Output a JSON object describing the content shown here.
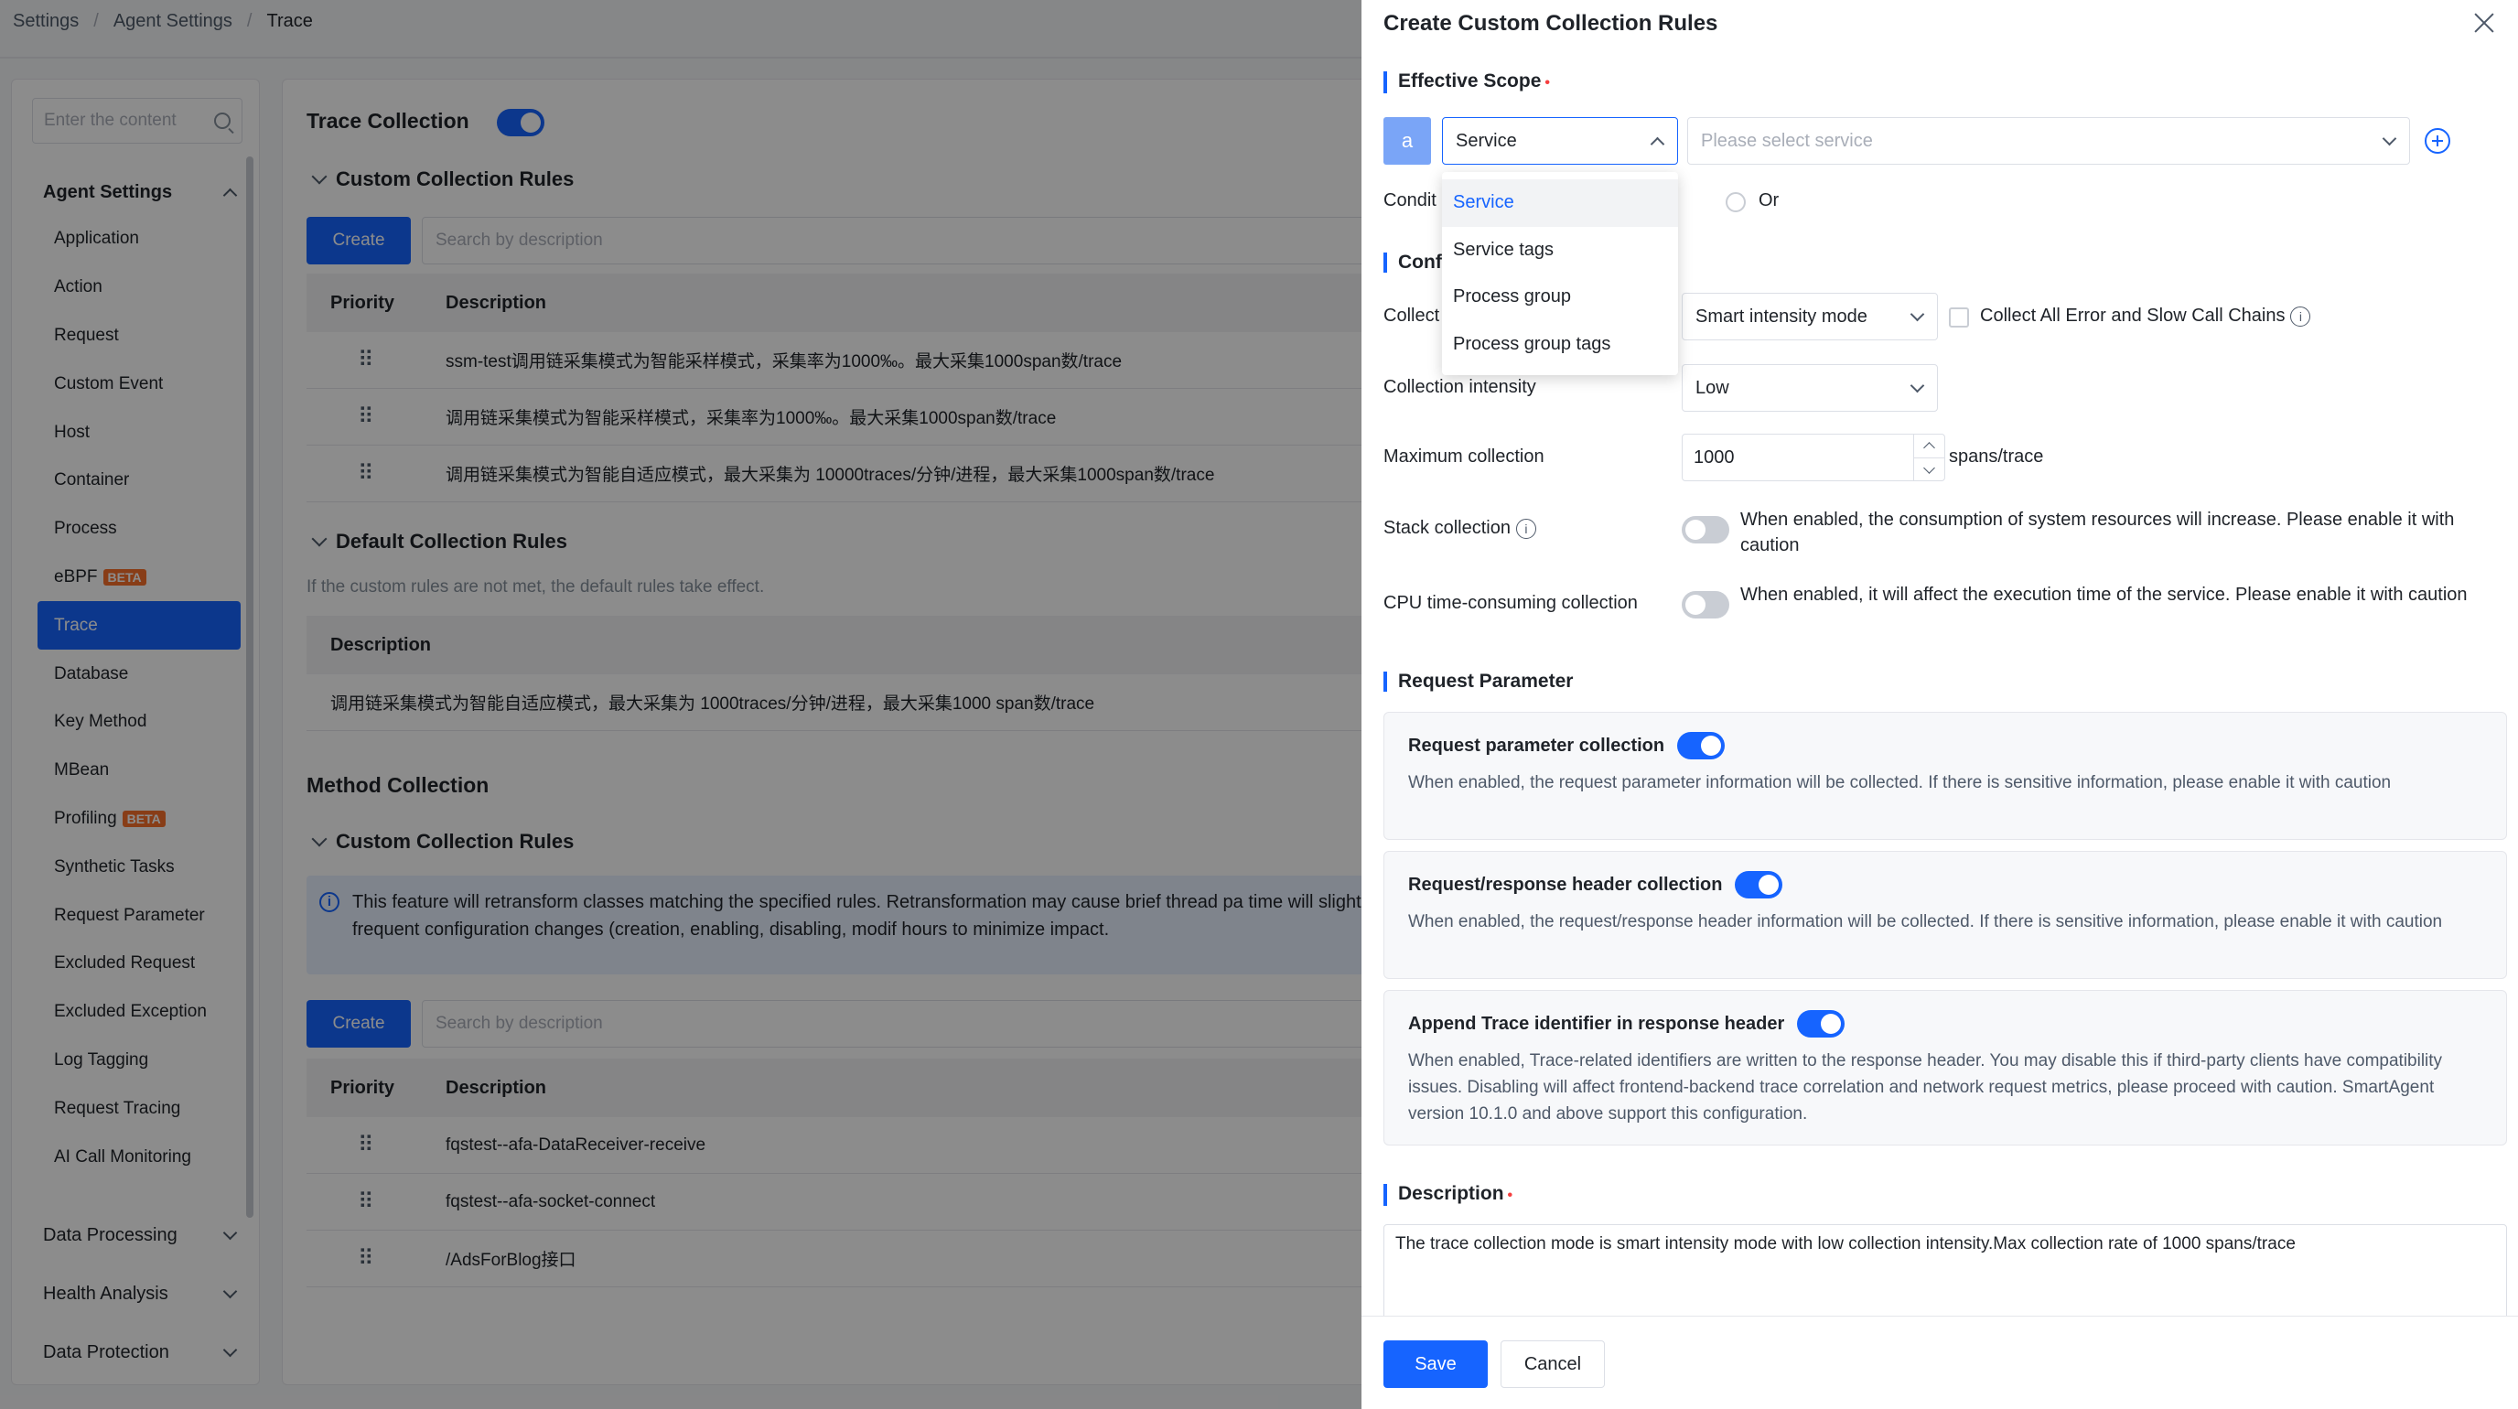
{
  "breadcrumb": [
    "Settings",
    "Agent Settings",
    "Trace"
  ],
  "sidebar": {
    "search_placeholder": "Enter the content",
    "group_title": "Agent Settings",
    "items": [
      {
        "label": "Application"
      },
      {
        "label": "Action"
      },
      {
        "label": "Request"
      },
      {
        "label": "Custom Event"
      },
      {
        "label": "Host"
      },
      {
        "label": "Container"
      },
      {
        "label": "Process"
      },
      {
        "label": "eBPF",
        "badge": "BETA"
      },
      {
        "label": "Trace",
        "active": true
      },
      {
        "label": "Database"
      },
      {
        "label": "Key Method"
      },
      {
        "label": "MBean"
      },
      {
        "label": "Profiling",
        "badge": "BETA"
      },
      {
        "label": "Synthetic Tasks"
      },
      {
        "label": "Request Parameter"
      },
      {
        "label": "Excluded Request"
      },
      {
        "label": "Excluded Exception"
      },
      {
        "label": "Log Tagging"
      },
      {
        "label": "Request Tracing"
      },
      {
        "label": "AI Call Monitoring"
      }
    ],
    "collapsed_groups": [
      "Data Processing",
      "Health Analysis",
      "Data Protection"
    ]
  },
  "main": {
    "trace_collection_title": "Trace Collection",
    "custom_rules_title": "Custom Collection Rules",
    "create_label": "Create",
    "search_placeholder": "Search by description",
    "col_priority": "Priority",
    "col_description": "Description",
    "custom_rules": [
      "ssm-test调用链采集模式为智能采样模式，采集率为1000‰。最大采集1000span数/trace",
      "调用链采集模式为智能采样模式，采集率为1000‰。最大采集1000span数/trace",
      "调用链采集模式为智能自适应模式，最大采集为 10000traces/分钟/进程，最大采集1000span数/trace"
    ],
    "default_rules_title": "Default Collection Rules",
    "default_rules_note": "If the custom rules are not met, the default rules take effect.",
    "default_rule": "调用链采集模式为智能自适应模式，最大采集为 1000traces/分钟/进程，最大采集1000 span数/trace",
    "method_collection_title": "Method Collection",
    "method_custom_rules_title": "Custom Collection Rules",
    "info_text": "This feature will retransform classes matching the specified rules. Retransformation may cause brief thread pa time will slightly increase. Therefore, avoid frequent configuration changes (creation, enabling, disabling, modif hours to minimize impact.",
    "method_rules": [
      "fqstest--afa-DataReceiver-receive",
      "fqstest--afa-socket-connect",
      "/AdsForBlog接口"
    ]
  },
  "drawer": {
    "title": "Create Custom Collection Rules",
    "effective_scope": "Effective Scope",
    "scope_tag": "a",
    "scope_type": "Service",
    "service_placeholder": "Please select service",
    "scope_options": [
      "Service",
      "Service tags",
      "Process group",
      "Process group tags"
    ],
    "condition_label": "Condit",
    "or_label": "Or",
    "config_label": "Confi",
    "collect_label": "Collect",
    "collect_mode": "Smart intensity mode",
    "collect_all_label": "Collect All Error and Slow Call Chains",
    "intensity_label": "Collection intensity",
    "intensity_value": "Low",
    "max_label": "Maximum collection",
    "max_value": "1000",
    "max_unit": "spans/trace",
    "stack_label": "Stack collection",
    "stack_hint": "When enabled, the consumption of system resources will increase. Please enable it with caution",
    "cpu_label": "CPU time-consuming collection",
    "cpu_hint": "When enabled, it will affect the execution time of the service. Please enable it with caution",
    "request_param_section": "Request Parameter",
    "cards": [
      {
        "title": "Request parameter collection",
        "desc": "When enabled, the request parameter information will be collected. If there is sensitive information, please enable it with caution"
      },
      {
        "title": "Request/response header collection",
        "desc": "When enabled, the request/response header information will be collected. If there is sensitive information, please enable it with caution"
      },
      {
        "title": "Append Trace identifier in response header",
        "desc": "When enabled, Trace-related identifiers are written to the response header. You may disable this if third-party clients have compatibility issues. Disabling will affect frontend-backend trace correlation and network request metrics, please proceed with caution. SmartAgent version 10.1.0 and above support this configuration."
      }
    ],
    "description_section": "Description",
    "description_value": "The trace collection mode is smart intensity mode with low collection intensity.Max collection rate of 1000 spans/trace",
    "save_label": "Save",
    "cancel_label": "Cancel"
  }
}
